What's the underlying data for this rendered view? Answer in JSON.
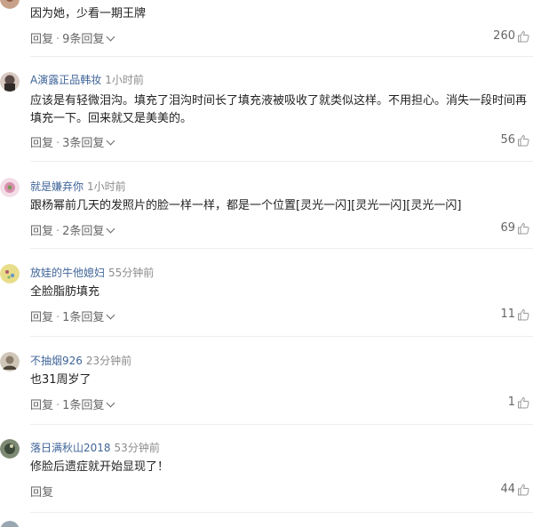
{
  "ui": {
    "reply_label": "回复",
    "separator": "·",
    "thumb_icon": "thumbs-up-icon"
  },
  "comments": [
    {
      "user": "",
      "time": "",
      "text": [
        "因为她，少看一期王牌"
      ],
      "reply_count": "9条回复",
      "likes": "260",
      "avatar_color": "#c7a18a"
    },
    {
      "user": "A演露正品韩妆",
      "time": "1小时前",
      "text": [
        "应该是有轻微泪沟。填充了泪沟时间长了填充液被吸收了就类似这样。不用担心。消失一段时间再",
        "填充一下。回来就又是美美的。"
      ],
      "reply_count": "3条回复",
      "likes": "56",
      "avatar_color": "#5a4a45"
    },
    {
      "user": "就是嫌弃你",
      "time": "1小时前",
      "text": [
        "跟杨幂前几天的发照片的脸一样一样，都是一个位置[灵光一闪][灵光一闪][灵光一闪]"
      ],
      "reply_count": "2条回复",
      "likes": "69",
      "avatar_color": "#d98fb0"
    },
    {
      "user": "放娃的牛他媳妇",
      "time": "55分钟前",
      "text": [
        "全脸脂肪填充"
      ],
      "reply_count": "1条回复",
      "likes": "11",
      "avatar_color": "#e8dd8a"
    },
    {
      "user": "不抽烟926",
      "time": "23分钟前",
      "text": [
        "也31周岁了"
      ],
      "reply_count": "1条回复",
      "likes": "1",
      "avatar_color": "#8a7c6a"
    },
    {
      "user": "落日满秋山2018",
      "time": "53分钟前",
      "text": [
        "修脸后遗症就开始显现了！"
      ],
      "reply_count": "",
      "likes": "44",
      "avatar_color": "#3c4a3a"
    }
  ]
}
